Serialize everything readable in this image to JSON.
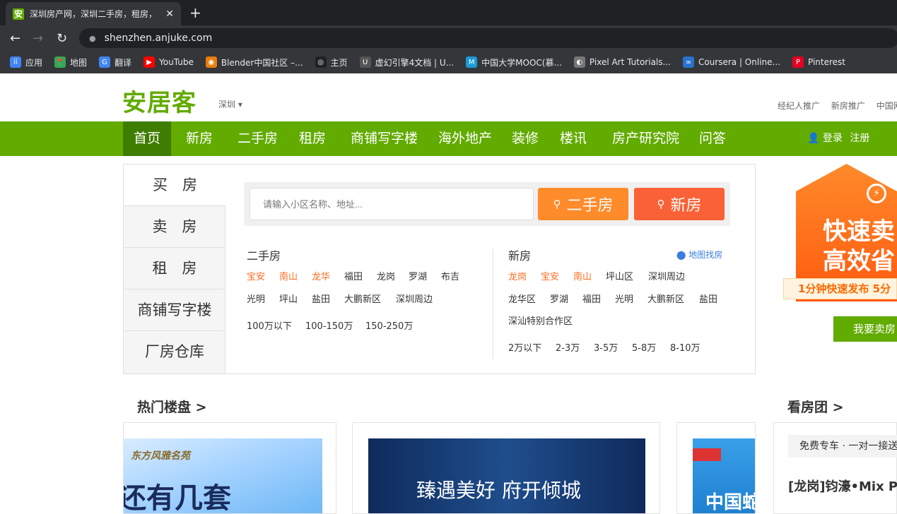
{
  "browser": {
    "tab_title": "深圳房产网，深圳二手房，租房，",
    "tab_favicon": "安",
    "tab_close": "✕",
    "new_tab": "+",
    "url": "shenzhen.anjuke.com",
    "bookmarks": [
      {
        "label": "应用",
        "icon": "apps-grid-icon",
        "color": "#4285f4"
      },
      {
        "label": "地图",
        "icon": "maps-pin-icon",
        "color": "#34a853"
      },
      {
        "label": "翻译",
        "icon": "translate-icon",
        "color": "#4285f4"
      },
      {
        "label": "YouTube",
        "icon": "youtube-icon",
        "color": "#ff0000"
      },
      {
        "label": "Blender中国社区 –...",
        "icon": "blender-icon",
        "color": "#e87d0d"
      },
      {
        "label": "主页",
        "icon": "home-icon",
        "color": "#202124"
      },
      {
        "label": "虚幻引擎4文档 | U...",
        "icon": "unreal-icon",
        "color": "#555"
      },
      {
        "label": "中国大学MOOC(慕...",
        "icon": "mooc-icon",
        "color": "#1a9ad6"
      },
      {
        "label": "Pixel Art Tutorials...",
        "icon": "globe-icon",
        "color": "#777"
      },
      {
        "label": "Coursera | Online...",
        "icon": "coursera-icon",
        "color": "#2a73cc"
      },
      {
        "label": "Pinterest",
        "icon": "pinterest-icon",
        "color": "#e60023"
      }
    ]
  },
  "header": {
    "logo": "安居客",
    "city": "深圳 ▾",
    "top_links": [
      "经纪人推广",
      "新房推广",
      "中国网"
    ]
  },
  "nav": {
    "items": [
      "首页",
      "新房",
      "二手房",
      "租房",
      "商铺写字楼",
      "海外地产",
      "装修",
      "楼讯",
      "房产研究院",
      "问答"
    ],
    "login": "登录",
    "register": "注册"
  },
  "search": {
    "side_tabs": [
      "买　房",
      "卖　房",
      "租　房",
      "商铺写字楼",
      "厂房仓库"
    ],
    "placeholder": "请输入小区名称、地址...",
    "btn_esf": "二手房",
    "btn_xf": "新房",
    "esf": {
      "title": "二手房",
      "row1": [
        "宝安",
        "南山",
        "龙华",
        "福田",
        "龙岗",
        "罗湖",
        "布吉"
      ],
      "row2": [
        "光明",
        "坪山",
        "盐田",
        "大鹏新区",
        "深圳周边"
      ],
      "row3": [
        "100万以下",
        "100-150万",
        "150-250万"
      ]
    },
    "xf": {
      "title": "新房",
      "map_link": "地图找房",
      "row1": [
        "龙岗",
        "宝安",
        "南山",
        "坪山区",
        "深圳周边"
      ],
      "row2": [
        "龙华区",
        "罗湖",
        "福田",
        "光明",
        "大鹏新区",
        "盐田"
      ],
      "row3": [
        "深汕特别合作区"
      ],
      "row4": [
        "2万以下",
        "2-3万",
        "3-5万",
        "5-8万",
        "8-10万"
      ]
    }
  },
  "ad": {
    "line1": "快速卖",
    "line2": "高效省",
    "strip": "1分钟快速发布 5分",
    "button": "我要卖房"
  },
  "sections": {
    "hot_title": "热门楼盘 >",
    "tour_title": "看房团 >",
    "card1_brand": "东方风雅名苑",
    "card1_text": "还有几套",
    "card2_text": "臻遇美好 府开倾城",
    "card3_text": "中国蛇",
    "tour_tags": "免费专车 · 一对一接送",
    "tour_name": "[龙岗]钧濠•Mix P"
  },
  "colors": {
    "brand_green": "#62ab00",
    "nav_active": "#3f7d00",
    "hot_orange": "#ff6c22",
    "btn_orange": "#ff8b2a",
    "btn_red": "#fa6136"
  }
}
